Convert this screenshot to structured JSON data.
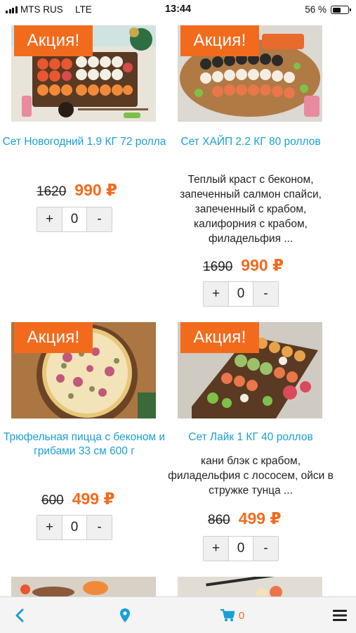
{
  "status_bar": {
    "carrier": "MTS RUS",
    "network": "LTE",
    "time": "13:44",
    "battery_percent": "56 %",
    "battery_level": 0.56
  },
  "sale_label": "Акция!",
  "products": [
    {
      "title": "Сет Новогодний 1.9 КГ 72 ролла",
      "description": "",
      "old_price": "1620",
      "new_price": "990 ₽",
      "quantity": "0",
      "plus": "+",
      "minus": "-"
    },
    {
      "title": "Сет ХАЙП 2.2 КГ 80 роллов",
      "description": "Теплый краст с беконом, запеченный салмон спайси, запеченный с крабом, калифорния с крабом, филадельфия ...",
      "old_price": "1690",
      "new_price": "990 ₽",
      "quantity": "0",
      "plus": "+",
      "minus": "-"
    },
    {
      "title": "Трюфельная пицца с беконом и грибами 33 см 600 г",
      "description": "",
      "old_price": "600",
      "new_price": "499 ₽",
      "quantity": "0",
      "plus": "+",
      "minus": "-"
    },
    {
      "title": "Сет Лайк 1 КГ 40 роллов",
      "description": "кани блэк с крабом, филадельфия с лососем, ойси в стружке тунца ...",
      "old_price": "860",
      "new_price": "499 ₽",
      "quantity": "0",
      "plus": "+",
      "minus": "-"
    }
  ],
  "bottom_bar": {
    "icons": [
      "chevron-left-icon",
      "map-pin-icon",
      "cart-icon",
      "menu-icon"
    ],
    "cart_count": "0"
  },
  "colors": {
    "accent": "#f26b1d",
    "link": "#1a9fd5",
    "nav_icon": "#1a9fd5"
  }
}
